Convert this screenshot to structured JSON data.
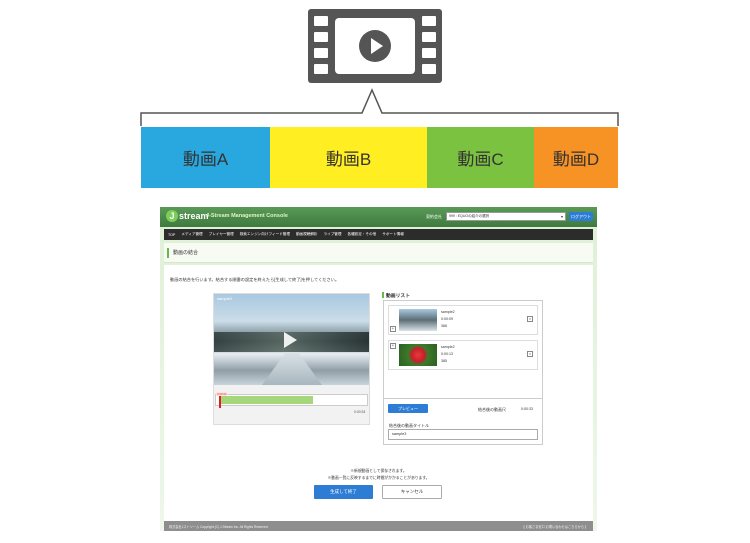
{
  "segments": [
    "動画A",
    "動画B",
    "動画C",
    "動画D"
  ],
  "colors": {
    "segment_a": "#29a8e0",
    "segment_b": "#ffee22",
    "segment_c": "#7cc241",
    "segment_d": "#f79324",
    "accent_green": "#68b84a",
    "button_blue": "#2e7dd4"
  },
  "icons": {
    "top": "film-strip-play-icon",
    "player_play": "play-icon"
  },
  "app": {
    "logo": "stream",
    "logo_letter": "J",
    "console_title": "J-Stream Management Console",
    "contract_label": "契約会社",
    "contract_value": "999 : EQUOの紹介の選択",
    "logout_label": "ログアウト",
    "nav": [
      "TOP",
      "メディア管理",
      "プレイヤー管理",
      "検索エンジン向けフィード管理",
      "動画視聴解析",
      "ライブ管理",
      "各種設定・その他",
      "サポート情報"
    ],
    "page_title": "動画の結合",
    "instruction": "動画の結合を行います。結合する順番の設定を終えたら[生成して終了]を押してください。",
    "video_label": "sample2",
    "timeline_marker": "0:00:00",
    "video_duration": "0:00:33",
    "list_title": "動画リスト",
    "list_items": [
      {
        "name": "sample2",
        "time": "0:00:09",
        "count": "366"
      },
      {
        "name": "sample2",
        "time": "0:00:13",
        "count": "385"
      }
    ],
    "preview_label": "プレビュー",
    "total_label": "結合後の動画尺",
    "total_value": "0:00:33",
    "title_label": "結合後の動画タイトル",
    "title_value": "sample3",
    "note1": "※新規動画として保存されます。",
    "note2": "※動画一覧に反映するまでに時間がかかることがあります。",
    "complete_label": "生成して終了",
    "cancel_label": "キャンセル",
    "footer_copy": "株式会社Jストリーム Copyright (C) J-Stream Inc. All Rights Reserved.",
    "footer_contact": "【 お客さま窓口 お問い合わせはこちらから 】"
  }
}
